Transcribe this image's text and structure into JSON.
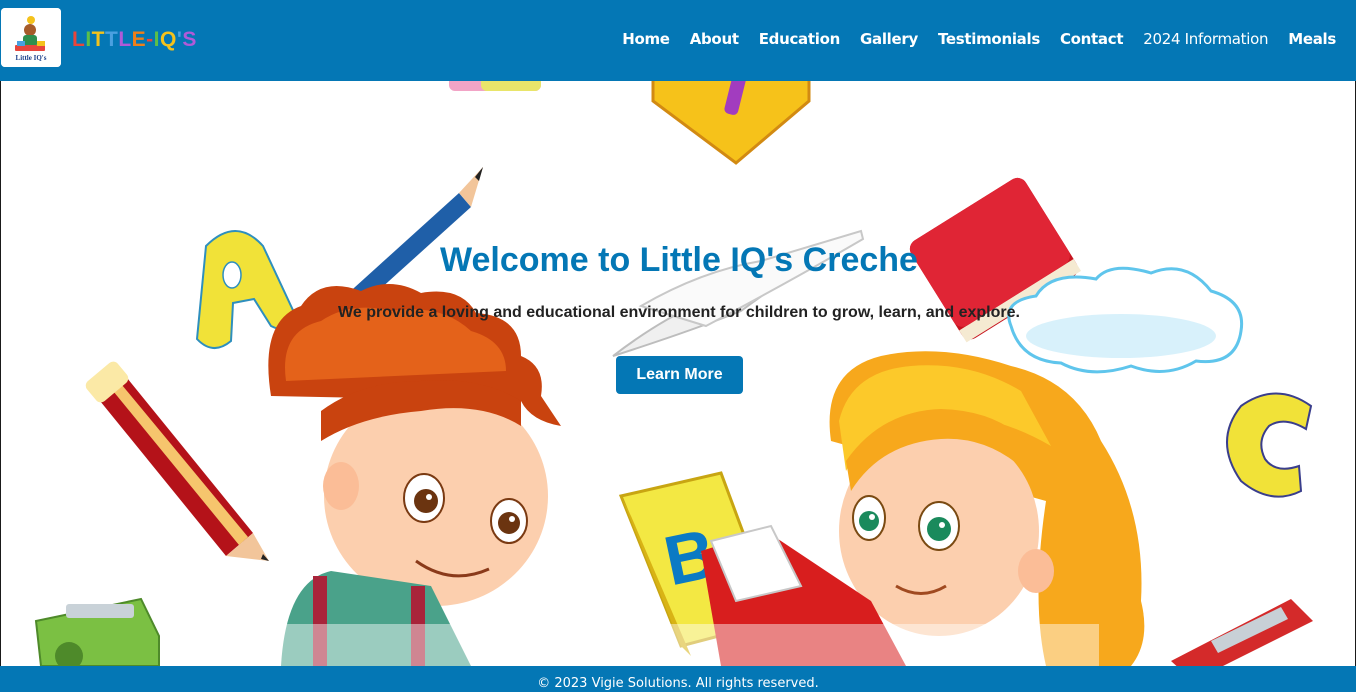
{
  "header": {
    "logo_alt": "Little IQ's",
    "brand": [
      "L",
      "I",
      "T",
      "T",
      "L",
      "E",
      "-",
      "I",
      "Q",
      "'",
      "S"
    ],
    "brand_colors": [
      "#e8453c",
      "#5bbf4a",
      "#f4c21c",
      "#4aa0e0",
      "#b05ad8",
      "#ef7f1a",
      "#e8453c",
      "#5bbf4a",
      "#f4c21c",
      "#4aa0e0",
      "#b05ad8"
    ]
  },
  "nav": {
    "items": [
      "Home",
      "About",
      "Education",
      "Gallery",
      "Testimonials",
      "Contact",
      "2024 Information",
      "Meals"
    ]
  },
  "hero": {
    "title": "Welcome to Little IQ's Creche",
    "subtitle": "We provide a loving and educational environment for children to grow, learn, and explore.",
    "cta_label": "Learn More"
  },
  "footer": {
    "text": "© 2023 Vigie Solutions. All rights reserved."
  },
  "colors": {
    "primary": "#0477b5",
    "background": "#ffffff"
  }
}
